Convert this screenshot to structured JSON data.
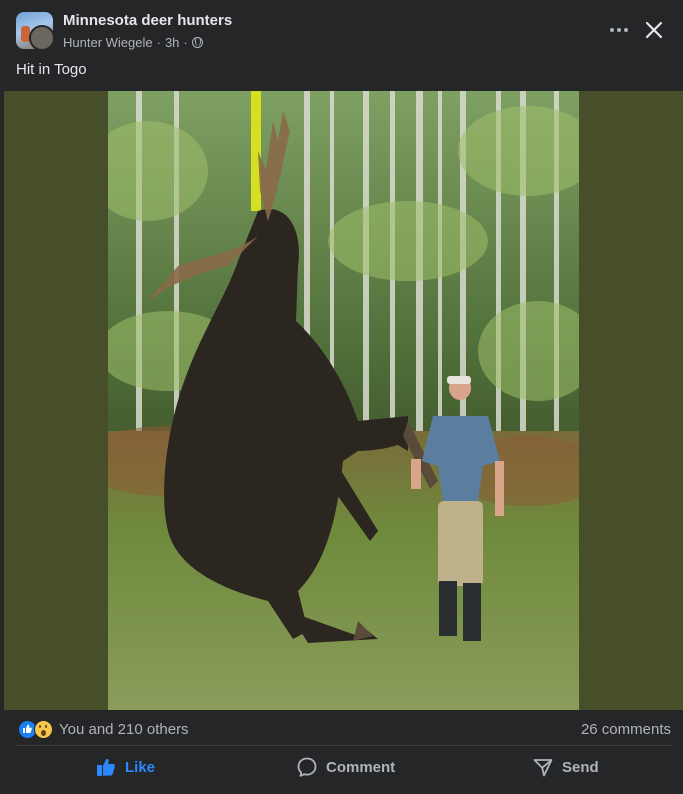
{
  "post": {
    "group_name": "Minnesota deer hunters",
    "author": "Hunter Wiegele",
    "time": "3h",
    "separator": "·",
    "caption": "Hit in Togo"
  },
  "photo": {
    "alt": "Man standing next to a large moose hoisted upright in front of a birch forest"
  },
  "reactions": {
    "summary": "You and 210 others",
    "comments": "26 comments",
    "icons": [
      "like-reaction-icon",
      "wow-reaction-icon"
    ]
  },
  "actions": {
    "like_label": "Like",
    "comment_label": "Comment",
    "send_label": "Send"
  },
  "colors": {
    "accent": "#2d88ff",
    "background": "#252627",
    "media_backdrop": "#474e2a",
    "text_secondary": "#b0b3b8"
  }
}
